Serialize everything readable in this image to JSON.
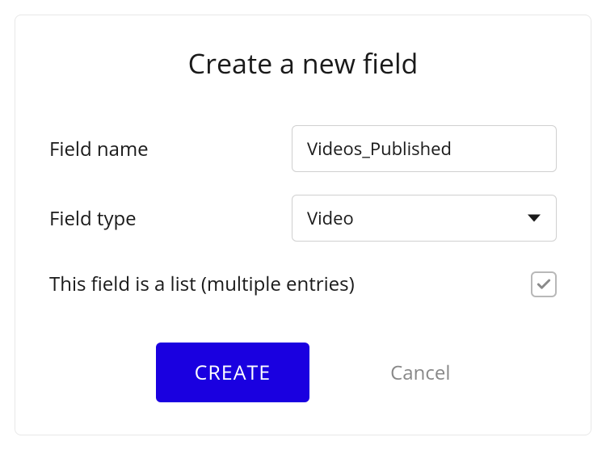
{
  "dialog": {
    "title": "Create a new field",
    "fieldNameLabel": "Field name",
    "fieldNameValue": "Videos_Published",
    "fieldTypeLabel": "Field type",
    "fieldTypeValue": "Video",
    "listCheckboxLabel": "This field is a list (multiple entries)",
    "listChecked": true,
    "createButton": "CREATE",
    "cancelButton": "Cancel"
  }
}
